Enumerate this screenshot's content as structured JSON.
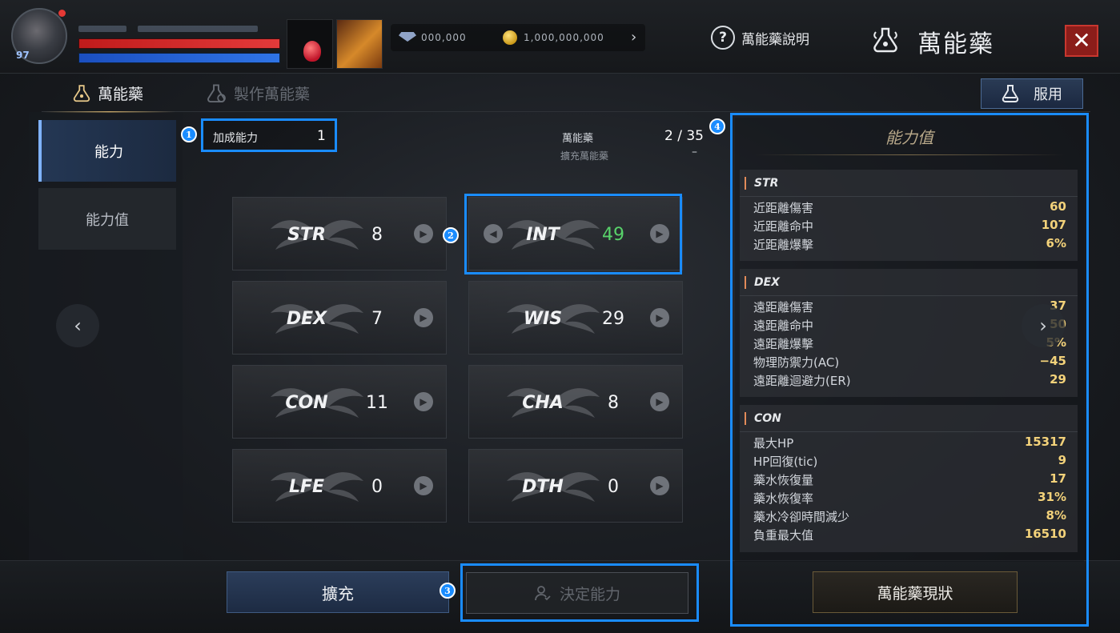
{
  "topbar": {
    "help_label": "萬能藥說明",
    "title": "萬能藥",
    "close_label": "✕",
    "currency_arrow": "›",
    "currency_1": "000,000",
    "currency_2": "1,000,000,000"
  },
  "tabs": {
    "potion": "萬能藥",
    "craft": "製作萬能藥"
  },
  "use_button": "服用",
  "side_nav": {
    "ability": "能力",
    "stats": "能力值"
  },
  "bonus": {
    "label": "加成能力",
    "value": "1"
  },
  "potion_count": {
    "label": "萬能藥",
    "value": "2 / 35"
  },
  "expand_info": {
    "label": "擴充萬能藥",
    "value": "–"
  },
  "badges": {
    "b1": "1",
    "b2": "2",
    "b3": "3",
    "b4": "4"
  },
  "stats_grid": [
    {
      "name": "STR",
      "value": "8"
    },
    {
      "name": "INT",
      "value": "49"
    },
    {
      "name": "DEX",
      "value": "7"
    },
    {
      "name": "WIS",
      "value": "29"
    },
    {
      "name": "CON",
      "value": "11"
    },
    {
      "name": "CHA",
      "value": "8"
    },
    {
      "name": "LFE",
      "value": "0"
    },
    {
      "name": "DTH",
      "value": "0"
    }
  ],
  "arrows": {
    "left": "◀",
    "right": "▶",
    "prev_page": "‹",
    "next_page": "›"
  },
  "bottom": {
    "expand": "擴充",
    "confirm": "決定能力",
    "status": "萬能藥現狀"
  },
  "stats_panel": {
    "title": "能力值",
    "groups": [
      {
        "name": "STR",
        "rows": [
          {
            "k": "近距離傷害",
            "v": "60"
          },
          {
            "k": "近距離命中",
            "v": "107"
          },
          {
            "k": "近距離爆擊",
            "v": "6%"
          }
        ]
      },
      {
        "name": "DEX",
        "rows": [
          {
            "k": "遠距離傷害",
            "v": "37"
          },
          {
            "k": "遠距離命中",
            "v": "50"
          },
          {
            "k": "遠距離爆擊",
            "v": "5%"
          },
          {
            "k": "物理防禦力(AC)",
            "v": "−45"
          },
          {
            "k": "遠距離迴避力(ER)",
            "v": "29"
          }
        ]
      },
      {
        "name": "CON",
        "rows": [
          {
            "k": "最大HP",
            "v": "15317"
          },
          {
            "k": "HP回復(tic)",
            "v": "9"
          },
          {
            "k": "藥水恢復量",
            "v": "17"
          },
          {
            "k": "藥水恢復率",
            "v": "31%"
          },
          {
            "k": "藥水冷卻時間減少",
            "v": "8%"
          },
          {
            "k": "負重最大值",
            "v": "16510"
          }
        ]
      }
    ]
  },
  "colors": {
    "accent_blue": "#1a8cff",
    "value_gold": "#f3d27a",
    "int_green": "#58d26a",
    "close_red": "#8b1d1a"
  }
}
